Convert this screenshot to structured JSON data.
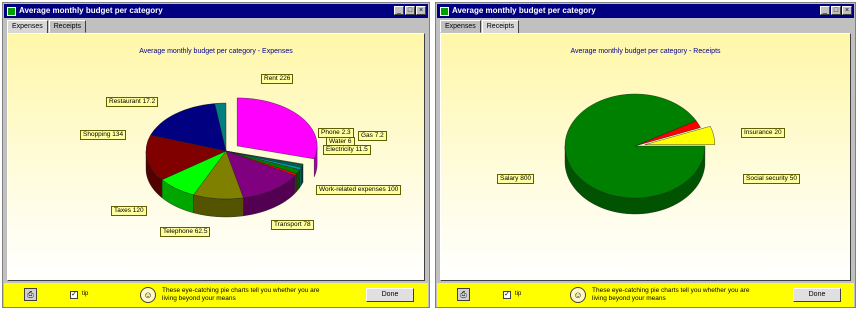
{
  "windows": [
    {
      "title": "Average monthly budget per category",
      "tabs": [
        {
          "label": "Expenses",
          "active": true
        },
        {
          "label": "Receipts",
          "active": false
        }
      ],
      "chart_data": {
        "type": "pie",
        "title": "Average monthly budget per category - Expenses",
        "slices": [
          {
            "label": "Rent 226",
            "value": 226,
            "color": "#ff00ff"
          },
          {
            "label": "Phone 2.3",
            "value": 2.3,
            "color": "#00c000"
          },
          {
            "label": "Gas 7.2",
            "value": 7.2,
            "color": "#006060"
          },
          {
            "label": "Water 6",
            "value": 6,
            "color": "#00a0a0"
          },
          {
            "label": "Electricity 11.5",
            "value": 11.5,
            "color": "#008000"
          },
          {
            "label": "Gift 5",
            "value": 5,
            "color": "#ff0000"
          },
          {
            "label": "Work-related expenses 100",
            "value": 100,
            "color": "#800080"
          },
          {
            "label": "Transport 78",
            "value": 78,
            "color": "#808000"
          },
          {
            "label": "Telephone 62.5",
            "value": 62.5,
            "color": "#00ff00"
          },
          {
            "label": "Taxes 120",
            "value": 120,
            "color": "#800000"
          },
          {
            "label": "Shopping 134",
            "value": 134,
            "color": "#000080"
          },
          {
            "label": "Restaurant 17.2",
            "value": 17.2,
            "color": "#008080"
          }
        ]
      },
      "footer": {
        "checkbox_label": "tip",
        "tip_text": "These eye-catching pie charts tell you whether you are living beyond your means",
        "done_label": "Done"
      }
    },
    {
      "title": "Average monthly budget per category",
      "tabs": [
        {
          "label": "Expenses",
          "active": false
        },
        {
          "label": "Receipts",
          "active": true
        }
      ],
      "chart_data": {
        "type": "pie",
        "title": "Average monthly budget per category - Receipts",
        "slices": [
          {
            "label": "Insurance 20",
            "value": 20,
            "color": "#ff0000"
          },
          {
            "label": "Social security 50",
            "value": 50,
            "color": "#ffff00"
          },
          {
            "label": "Salary 800",
            "value": 800,
            "color": "#008000"
          }
        ]
      },
      "footer": {
        "checkbox_label": "tip",
        "tip_text": "These eye-catching pie charts tell you whether you are living beyond your means",
        "done_label": "Done"
      }
    }
  ]
}
